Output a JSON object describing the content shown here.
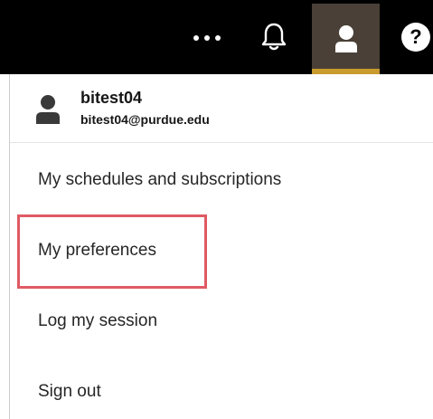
{
  "top_bar": {
    "icons": [
      "more-horizontal-icon",
      "notification-bell-icon",
      "user-icon",
      "help-icon"
    ],
    "help_glyph": "?",
    "background_color": "#000000",
    "active_tab_color": "#4a4037",
    "active_indicator_color": "#c99a2e"
  },
  "profile": {
    "username": "bitest04",
    "email": "bitest04@purdue.edu",
    "icon": "person-icon"
  },
  "menu": {
    "items": [
      {
        "label": "My schedules and subscriptions"
      },
      {
        "label": "My preferences"
      },
      {
        "label": "Log my session"
      },
      {
        "label": "Sign out"
      }
    ]
  },
  "highlight": {
    "target": "My preferences",
    "color": "#e05a63"
  }
}
